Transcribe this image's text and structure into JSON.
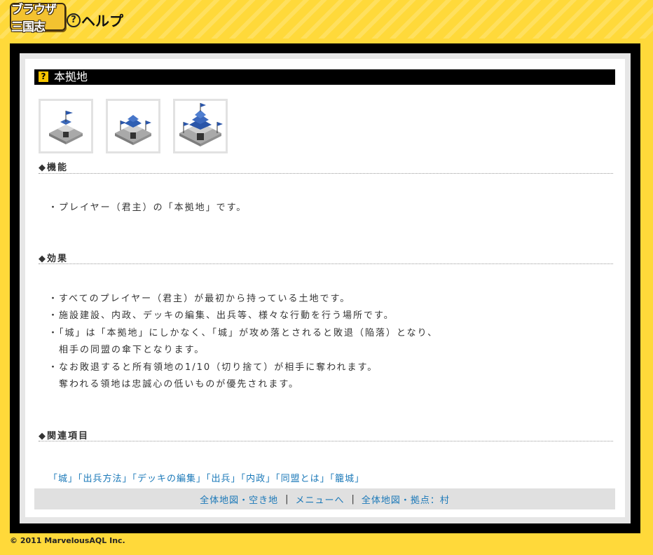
{
  "header": {
    "logo_text": "ブラウザ三国志",
    "help_icon": "question-circle-icon",
    "title": "ヘルプ"
  },
  "page": {
    "heading_icon": "question-icon",
    "heading": "本拠地",
    "castle_images": [
      "castle-level-1-icon",
      "castle-level-2-icon",
      "castle-level-3-icon"
    ]
  },
  "sections": {
    "function": {
      "title": "◆機能",
      "lines": [
        "・プレイヤー（君主）の「本拠地」です。"
      ]
    },
    "effect": {
      "title": "◆効果",
      "lines": [
        "・すべてのプレイヤー（君主）が最初から持っている土地です。",
        "・施設建設、内政、デッキの編集、出兵等、様々な行動を行う場所です。",
        "・「城」は「本拠地」にしかなく、「城」が攻め落とされると敗退（陥落）となり、",
        "相手の同盟の傘下となります。",
        "・なお敗退すると所有領地の1/10（切り捨て）が相手に奪われます。",
        "奪われる領地は忠誠心の低いものが優先されます。"
      ]
    },
    "related": {
      "title": "◆関連項目",
      "links": [
        "「城」",
        "「出兵方法」",
        "「デッキの編集」",
        "「出兵」",
        "「内政」",
        "「同盟とは」",
        "「籠城」"
      ]
    }
  },
  "footer_nav": {
    "links": [
      "全体地図・空き地",
      "メニューへ",
      "全体地図・拠点：村"
    ],
    "separator": "|"
  },
  "copyright": "© 2011 MarvelousAQL Inc.",
  "colors": {
    "background": "#ffd93a",
    "frame": "#000000",
    "link": "#1a78b8",
    "heading_icon": "#f5c400"
  }
}
